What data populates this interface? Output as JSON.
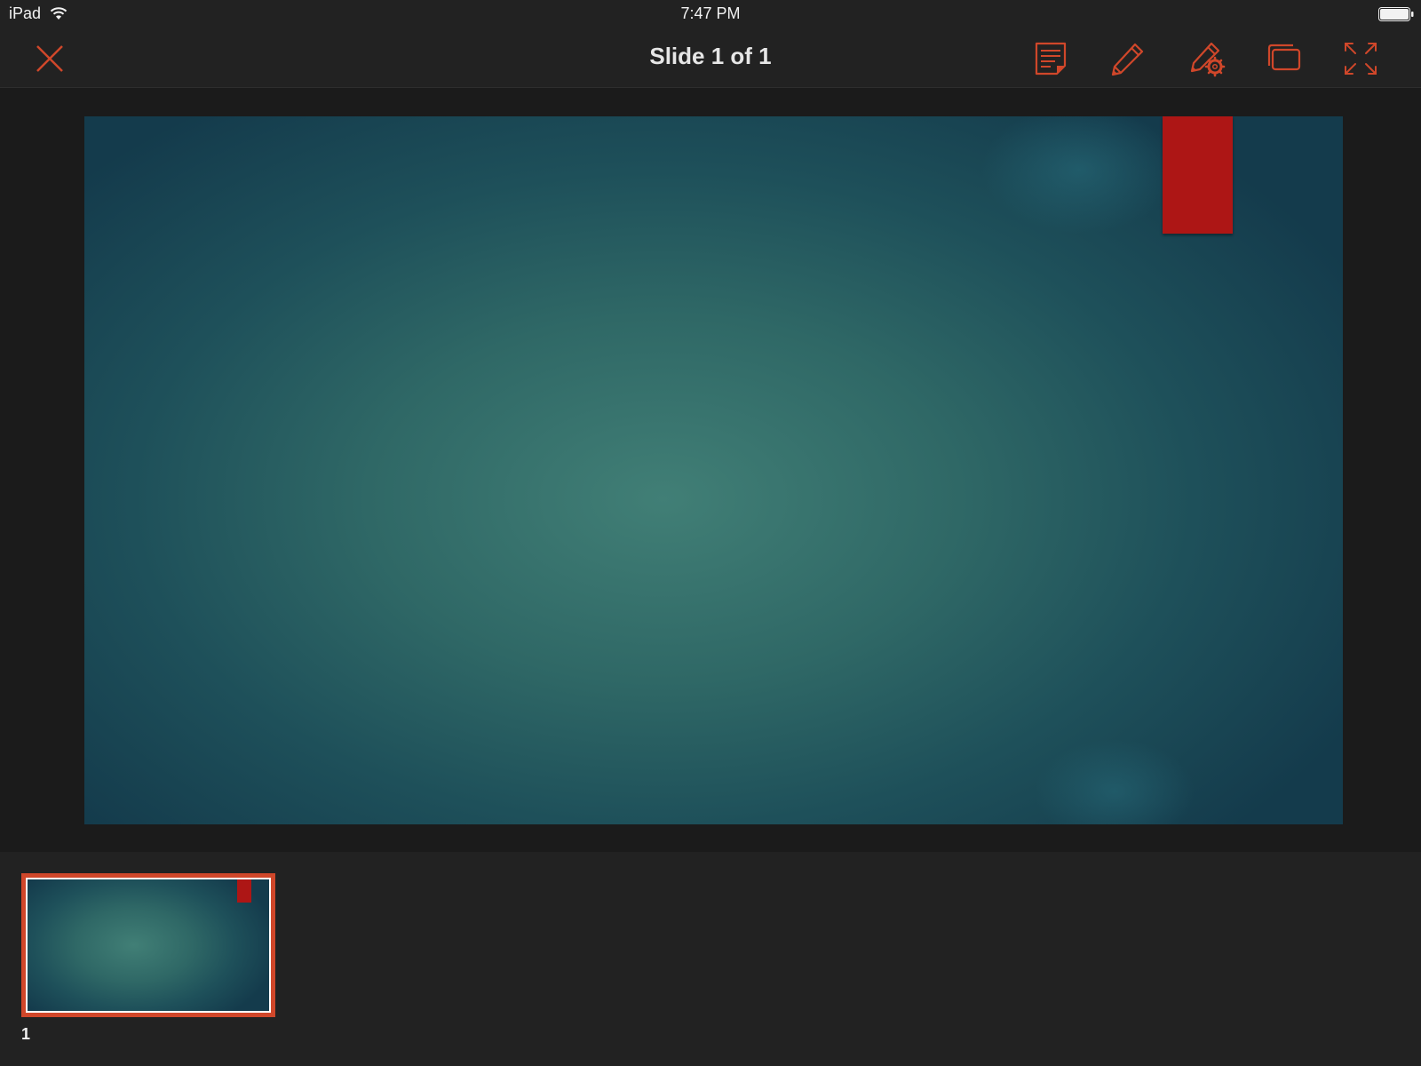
{
  "status_bar": {
    "device": "iPad",
    "time": "7:47 PM",
    "icons": [
      "wifi-icon",
      "battery-icon"
    ]
  },
  "toolbar": {
    "title": "Slide 1 of 1",
    "accent_color": "#d0472a",
    "buttons": [
      {
        "name": "close-button",
        "icon": "close-icon"
      },
      {
        "name": "notes-button",
        "icon": "notes-icon"
      },
      {
        "name": "pen-button",
        "icon": "pen-icon"
      },
      {
        "name": "pen-settings-button",
        "icon": "pen-settings-icon"
      },
      {
        "name": "switch-window-button",
        "icon": "window-icon"
      },
      {
        "name": "fullscreen-button",
        "icon": "fullscreen-icon"
      }
    ]
  },
  "slide": {
    "tab_color": "#ad1615",
    "background_colors": [
      "#417f76",
      "#143b4c"
    ]
  },
  "thumbnails": [
    {
      "number": "1",
      "selected": true
    }
  ]
}
